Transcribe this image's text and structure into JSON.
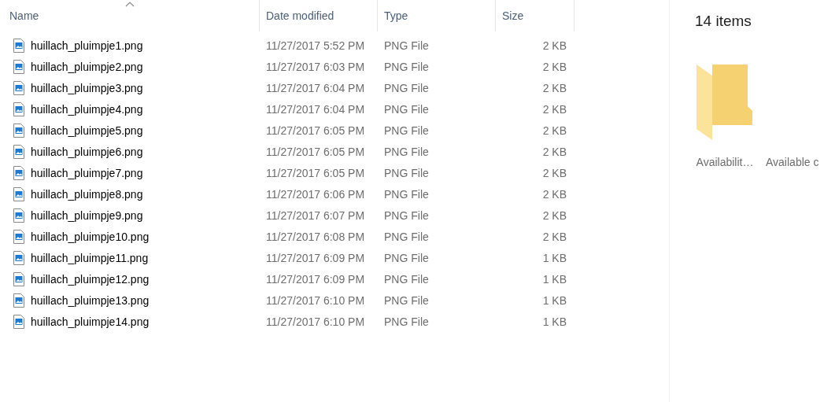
{
  "file_list": {
    "columns": [
      {
        "label": "Name",
        "sorted": true
      },
      {
        "label": "Date modified",
        "sorted": false
      },
      {
        "label": "Type",
        "sorted": false
      },
      {
        "label": "Size",
        "sorted": false
      }
    ],
    "rows": [
      {
        "name": "huillach_pluimpje1.png",
        "date": "11/27/2017 5:52 PM",
        "type": "PNG File",
        "size": "2 KB"
      },
      {
        "name": "huillach_pluimpje2.png",
        "date": "11/27/2017 6:03 PM",
        "type": "PNG File",
        "size": "2 KB"
      },
      {
        "name": "huillach_pluimpje3.png",
        "date": "11/27/2017 6:04 PM",
        "type": "PNG File",
        "size": "2 KB"
      },
      {
        "name": "huillach_pluimpje4.png",
        "date": "11/27/2017 6:04 PM",
        "type": "PNG File",
        "size": "2 KB"
      },
      {
        "name": "huillach_pluimpje5.png",
        "date": "11/27/2017 6:05 PM",
        "type": "PNG File",
        "size": "2 KB"
      },
      {
        "name": "huillach_pluimpje6.png",
        "date": "11/27/2017 6:05 PM",
        "type": "PNG File",
        "size": "2 KB"
      },
      {
        "name": "huillach_pluimpje7.png",
        "date": "11/27/2017 6:05 PM",
        "type": "PNG File",
        "size": "2 KB"
      },
      {
        "name": "huillach_pluimpje8.png",
        "date": "11/27/2017 6:06 PM",
        "type": "PNG File",
        "size": "2 KB"
      },
      {
        "name": "huillach_pluimpje9.png",
        "date": "11/27/2017 6:07 PM",
        "type": "PNG File",
        "size": "2 KB"
      },
      {
        "name": "huillach_pluimpje10.png",
        "date": "11/27/2017 6:08 PM",
        "type": "PNG File",
        "size": "2 KB"
      },
      {
        "name": "huillach_pluimpje11.png",
        "date": "11/27/2017 6:09 PM",
        "type": "PNG File",
        "size": "1 KB"
      },
      {
        "name": "huillach_pluimpje12.png",
        "date": "11/27/2017 6:09 PM",
        "type": "PNG File",
        "size": "1 KB"
      },
      {
        "name": "huillach_pluimpje13.png",
        "date": "11/27/2017 6:10 PM",
        "type": "PNG File",
        "size": "1 KB"
      },
      {
        "name": "huillach_pluimpje14.png",
        "date": "11/27/2017 6:10 PM",
        "type": "PNG File",
        "size": "1 KB"
      }
    ]
  },
  "details_pane": {
    "item_count": "14 items",
    "folders": [
      {
        "label": "Availabilit…"
      },
      {
        "label": "Available c"
      }
    ]
  }
}
